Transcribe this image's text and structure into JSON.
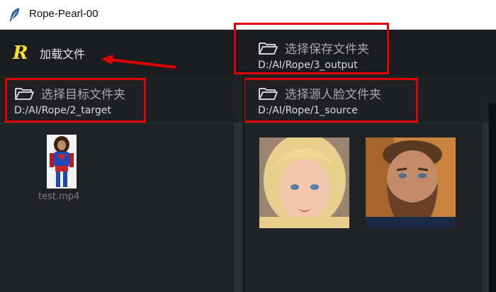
{
  "window": {
    "title": "Rope-Pearl-00"
  },
  "toolbar": {
    "load_label": "加载文件",
    "logo_letter": "R"
  },
  "output": {
    "button_label": "选择保存文件夹",
    "path": "D:/AI/Rope/3_output"
  },
  "target": {
    "button_label": "选择目标文件夹",
    "path": "D:/AI/Rope/2_target",
    "files": [
      {
        "name": "test.mp4"
      }
    ]
  },
  "source": {
    "button_label": "选择源人脸文件夹",
    "path": "D:/AI/Rope/1_source",
    "faces": [
      {
        "name": "blonde-woman-face"
      },
      {
        "name": "bearded-man-face"
      }
    ]
  },
  "colors": {
    "annotation": "#e00000",
    "logo": "#f3e12a",
    "background": "#1f2024"
  }
}
